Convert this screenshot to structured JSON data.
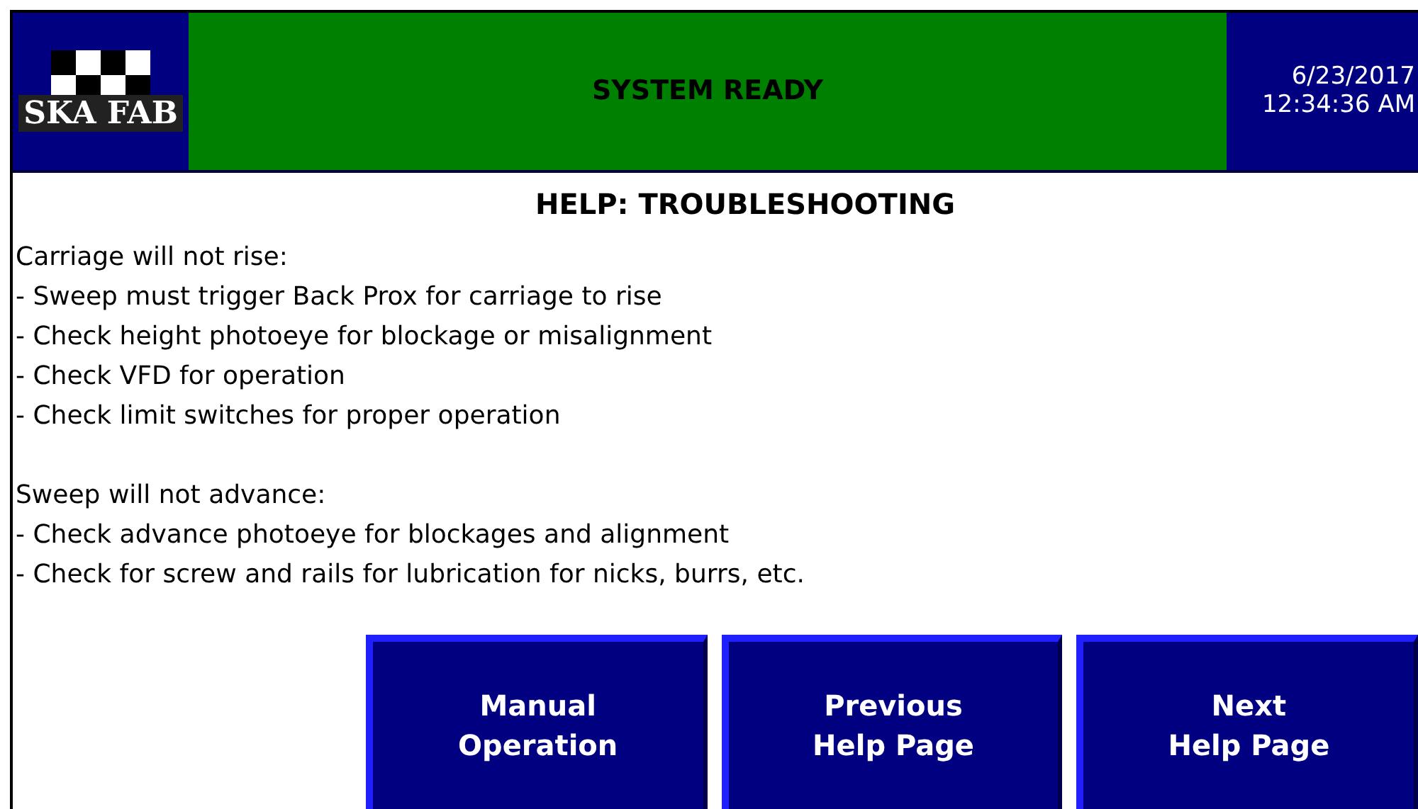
{
  "header": {
    "logo": {
      "text": "SKA FAB"
    },
    "status": "SYSTEM READY",
    "date": "6/23/2017",
    "time": "12:34:36 AM"
  },
  "title": "HELP: TROUBLESHOOTING",
  "sections": [
    {
      "heading": "Carriage will not rise:",
      "items": [
        "- Sweep must trigger Back Prox for carriage to rise",
        "- Check height photoeye for blockage or misalignment",
        "- Check VFD for operation",
        "- Check limit switches for proper operation"
      ]
    },
    {
      "heading": "Sweep will not advance:",
      "items": [
        "- Check advance photoeye for blockages and alignment",
        "- Check for screw and rails for lubrication for nicks, burrs, etc."
      ]
    }
  ],
  "buttons": [
    {
      "lines": [
        "Manual",
        "Operation"
      ]
    },
    {
      "lines": [
        "Previous",
        "Help Page"
      ]
    },
    {
      "lines": [
        "Next",
        "Help Page"
      ]
    }
  ]
}
